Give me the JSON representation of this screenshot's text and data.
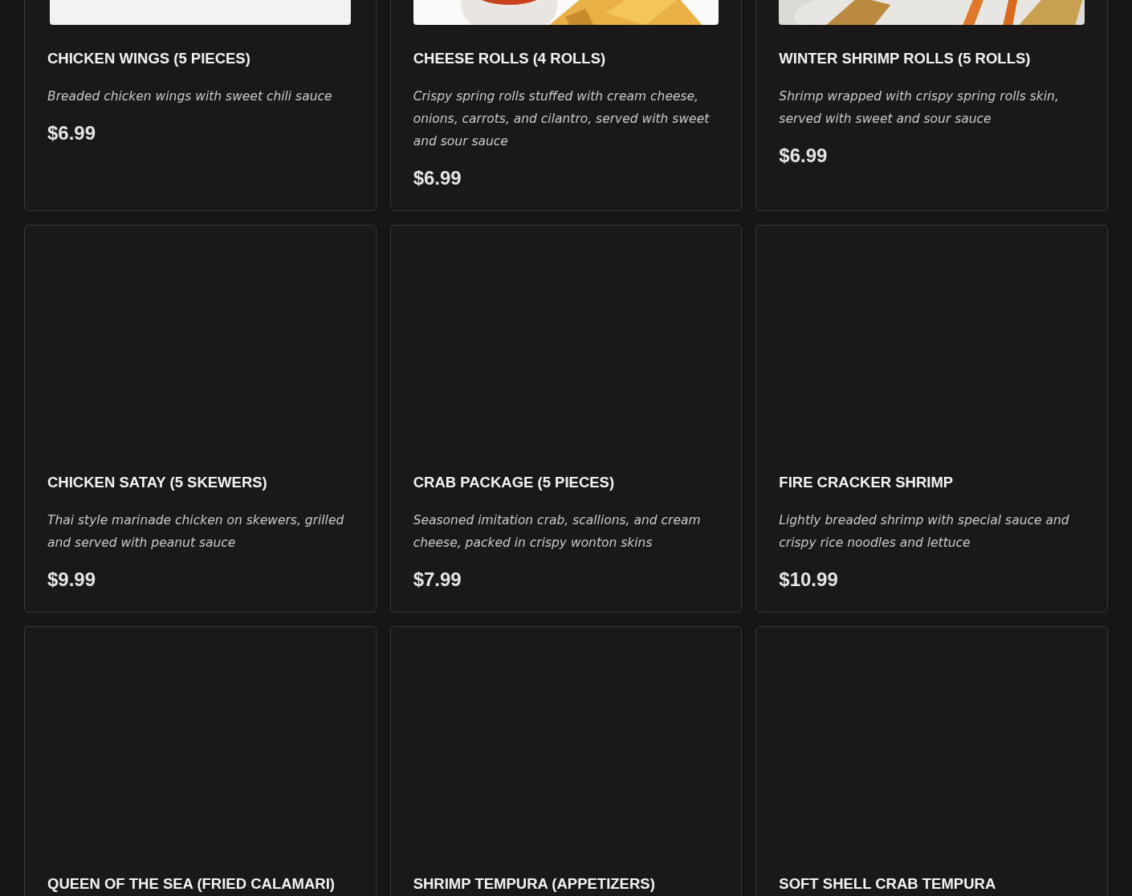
{
  "menu_items": [
    {
      "image": {
        "kind": "placeholder"
      },
      "name": "CHICKEN WINGS (5 PIECES)",
      "description": "Breaded chicken wings with sweet chili sauce",
      "price": "$6.99"
    },
    {
      "name": "CHEESE ROLLS (4 ROLLS)",
      "description": "Crispy spring rolls stuffed with cream cheese, onions, carrots, and cilantro, served with sweet and sour sauce",
      "price": "$6.99"
    },
    {
      "name": "WINTER SHRIMP ROLLS (5 ROLLS)",
      "description": "Shrimp wrapped with crispy spring rolls skin, served with sweet and sour sauce",
      "price": "$6.99"
    },
    {
      "name": "CHICKEN SATAY (5 SKEWERS)",
      "description": "Thai style marinade chicken on skewers, grilled and served with peanut sauce",
      "price": "$9.99"
    },
    {
      "name": "CRAB PACKAGE (5 PIECES)",
      "description": "Seasoned imitation crab, scallions, and cream cheese, packed in crispy wonton skins",
      "price": "$7.99"
    },
    {
      "name": "FIRE CRACKER SHRIMP",
      "description": "Lightly breaded shrimp with special sauce and crispy rice noodles and lettuce",
      "price": "$10.99"
    },
    {
      "name": "QUEEN OF THE SEA (FRIED CALAMARI)"
    },
    {
      "name": "SHRIMP TEMPURA (APPETIZERS)"
    },
    {
      "name": "SOFT SHELL CRAB TEMPURA"
    }
  ]
}
